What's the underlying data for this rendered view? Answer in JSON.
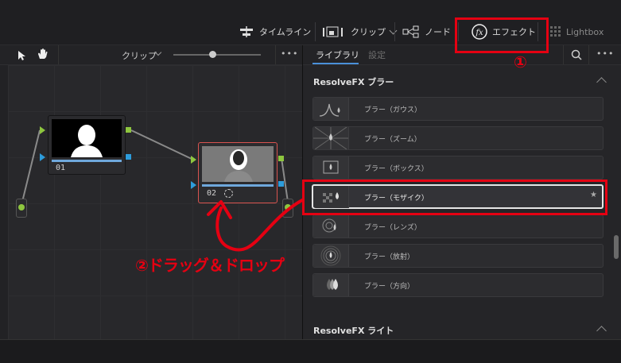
{
  "toolbar": {
    "timeline_label": "タイムライン",
    "clip_label": "クリップ",
    "node_label": "ノード",
    "effects_label": "エフェクト",
    "lightbox_label": "Lightbox"
  },
  "node_editor": {
    "clip_dropdown": "クリップ",
    "more": "•••",
    "nodes": [
      {
        "number": "01"
      },
      {
        "number": "02"
      }
    ]
  },
  "library": {
    "tabs": [
      "ライブラリ",
      "設定"
    ],
    "more": "•••",
    "sections": [
      {
        "title": "ResolveFX ブラー",
        "items": [
          {
            "label": "ブラー（ガウス）",
            "icon": "gaussian-curve-icon"
          },
          {
            "label": "ブラー（ズーム）",
            "icon": "zoom-burst-icon"
          },
          {
            "label": "ブラー（ボックス）",
            "icon": "box-blur-icon"
          },
          {
            "label": "ブラー（モザイク）",
            "icon": "mosaic-icon",
            "selected": true
          },
          {
            "label": "ブラー（レンズ）",
            "icon": "lens-icon"
          },
          {
            "label": "ブラー（放射）",
            "icon": "radial-icon"
          },
          {
            "label": "ブラー（方向）",
            "icon": "directional-icon"
          }
        ]
      },
      {
        "title": "ResolveFX ライト"
      }
    ]
  },
  "annotations": {
    "step1": "①",
    "step2": "②ドラッグ＆ドロップ"
  },
  "colors": {
    "annotation_red": "#e50012",
    "node_green": "#8ec63f",
    "node_blue": "#2d9cdb"
  }
}
